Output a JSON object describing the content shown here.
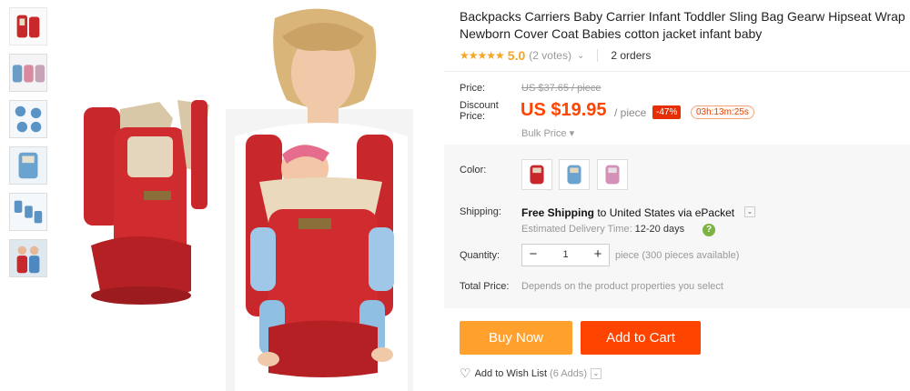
{
  "product": {
    "title": "Backpacks Carriers Baby Carrier Infant Toddler Sling Bag Gearw Hipseat Wrap Newborn Cover Coat Babies cotton jacket infant baby",
    "rating_stars": "★★★★★",
    "rating_value": "5.0",
    "votes": "(2 votes)",
    "orders": "2 orders"
  },
  "price": {
    "label": "Price:",
    "old_value": "US $37.65 / piece",
    "discount_label": "Discount Price:",
    "new_value": "US $19.95",
    "per_unit": "/ piece",
    "discount_pct": "-47%",
    "timer": "03h:13m:25s",
    "bulk_label": "Bulk Price ▾"
  },
  "options": {
    "color_label": "Color:",
    "colors": [
      "red",
      "blue",
      "pink"
    ]
  },
  "shipping": {
    "label": "Shipping:",
    "free_text": "Free Shipping",
    "dest_text": " to United States via ePacket",
    "est_label": "Estimated Delivery Time:",
    "est_value": "12-20 days"
  },
  "quantity": {
    "label": "Quantity:",
    "minus": "−",
    "value": "1",
    "plus": "+",
    "note": "piece (300 pieces available)"
  },
  "total": {
    "label": "Total Price:",
    "note": "Depends on the product properties you select"
  },
  "actions": {
    "buy_now": "Buy Now",
    "add_to_cart": "Add to Cart",
    "wishlist": "Add to Wish List",
    "wishlist_count": "(6 Adds)"
  },
  "colors": {
    "accent_orange": "#ff4400",
    "buy_now": "#ffa12c",
    "star": "#f5a623",
    "carrier_red": "#d02b2f"
  }
}
